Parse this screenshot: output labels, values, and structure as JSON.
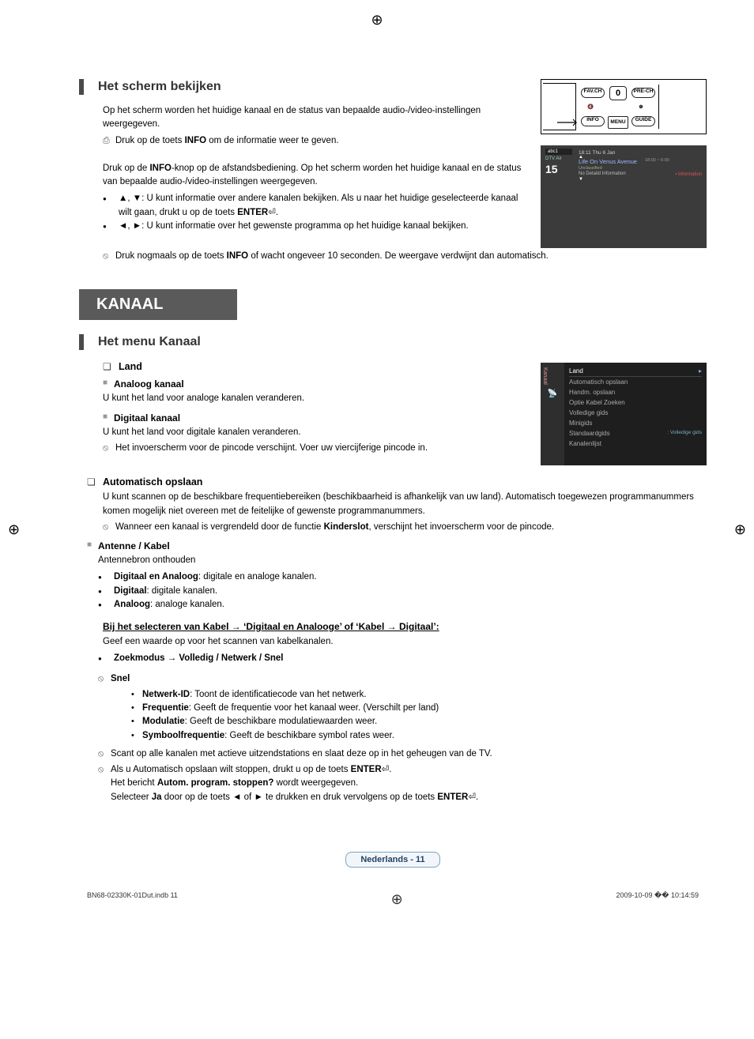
{
  "section1": {
    "title": "Het scherm bekijken",
    "p1": "Op het scherm worden het huidige kanaal en de status van bepaalde audio-/video-instellingen weergegeven.",
    "p2_pre": "Druk op de toets ",
    "p2_bold": "INFO",
    "p2_post": " om de informatie weer te geven.",
    "p3_pre": "Druk op de ",
    "p3_bold": "INFO",
    "p3_post": "-knop op de afstandsbediening. Op het scherm worden het huidige kanaal en de status van bepaalde audio-/video-instellingen weergegeven.",
    "b1_pre": "▲, ▼: U kunt informatie over andere kanalen bekijken. Als u naar het huidige geselecteerde kanaal wilt gaan, drukt u  op de toets ",
    "b1_bold": "ENTER",
    "b1_post": "⏎.",
    "b2": "◄, ►: U kunt informatie over het gewenste programma op het huidige kanaal bekijken.",
    "note_pre": "Druk nogmaals op de toets ",
    "note_bold": "INFO",
    "note_post": " of wacht ongeveer 10 seconden. De weergave verdwijnt dan automatisch."
  },
  "remote": {
    "favch": "FAV.CH",
    "zero": "0",
    "prech": "PRE-CH",
    "mute_sym": "🔇",
    "plus_sym": "⊕",
    "info": "INFO",
    "menu": "MENU",
    "guide": "GUIDE"
  },
  "osd": {
    "tag": "abc1",
    "netlabel": "DTV Air",
    "ch": "15",
    "date": "18:11 Thu 6 Jan",
    "prog": "Life On Venus Avenue",
    "sub": "Unclassified",
    "extra": "No Detaild Information",
    "time": "18:00 ~ 6:00",
    "infoword": "Information"
  },
  "banner": "KANAAL",
  "section2_title": "Het menu Kanaal",
  "land": {
    "q": "Land",
    "s1": "Analoog kanaal",
    "s1_desc": "U kunt het land voor analoge kanalen veranderen.",
    "s2": "Digitaal kanaal",
    "s2_desc": "U kunt het land voor digitale kanalen veranderen.",
    "s2_note": "Het invoerscherm voor de pincode verschijnt. Voer uw viercijferige pincode in."
  },
  "menu": {
    "head": "Land",
    "items": [
      "Automatisch opslaan",
      "Handm. opslaan",
      "Optie Kabel Zoeken",
      "Volledige gids",
      "Minigids",
      "Standaardgids",
      "Kanalenlijst"
    ],
    "rightval": "Volledige gids"
  },
  "auto": {
    "q": "Automatisch opslaan",
    "p1": "U kunt scannen op de beschikbare frequentiebereiken (beschikbaarheid is afhankelijk van uw land). Automatisch toegewezen programmanummers komen mogelijk niet overeen met de feitelijke of gewenste programmanummers.",
    "note_pre": "Wanneer een kanaal is vergrendeld door de functie ",
    "note_bold": "Kinderslot",
    "note_post": ", verschijnt het invoerscherm voor de pincode.",
    "sq": "Antenne / Kabel",
    "sq_desc": "Antennebron onthouden",
    "b1_pre": "Digitaal en Analoog",
    "b1_post": ": digitale en analoge kanalen.",
    "b2_pre": "Digitaal",
    "b2_post": ": digitale kanalen.",
    "b3_pre": "Analoog",
    "b3_post": ": analoge kanalen."
  },
  "kabel": {
    "u": "Bij het selecteren van Kabel → ‘Digitaal en Analooge’ of ‘Kabel → Digitaal’:",
    "p1": "Geef een waarde op voor het scannen van kabelkanalen.",
    "b1": "Zoekmodus → Volledig / Netwerk / Snel",
    "snel": "Snel",
    "d1_pre": "Netwerk-ID",
    "d1_post": ": Toont de identificatiecode van het netwerk.",
    "d2_pre": "Frequentie",
    "d2_post": ": Geeft de frequentie voor het kanaal weer. (Verschilt per land)",
    "d3_pre": "Modulatie",
    "d3_post": ": Geeft de beschikbare modulatiewaarden weer.",
    "d4_pre": "Symboolfrequentie",
    "d4_post": ": Geeft de beschikbare symbol rates weer.",
    "n1": "Scant op alle kanalen met actieve uitzendstations en slaat deze op in het geheugen van de TV.",
    "n2_pre": "Als u Automatisch opslaan wilt stoppen, drukt u op de toets ",
    "n2_bold": "ENTER",
    "n2_post": "⏎.",
    "n3_pre": "Het bericht ",
    "n3_bold": "Autom. program. stoppen?",
    "n3_post": " wordt weergegeven.",
    "n4_pre": "Selecteer ",
    "n4_bold1": "Ja",
    "n4_mid": " door op de toets ◄ of ► te drukken en druk vervolgens op de toets ",
    "n4_bold2": "ENTER",
    "n4_post": "⏎."
  },
  "pagenum": "Nederlands - 11",
  "footer": {
    "left": "BN68-02330K-01Dut.indb   11",
    "right": "2009-10-09   �� 10:14:59"
  }
}
